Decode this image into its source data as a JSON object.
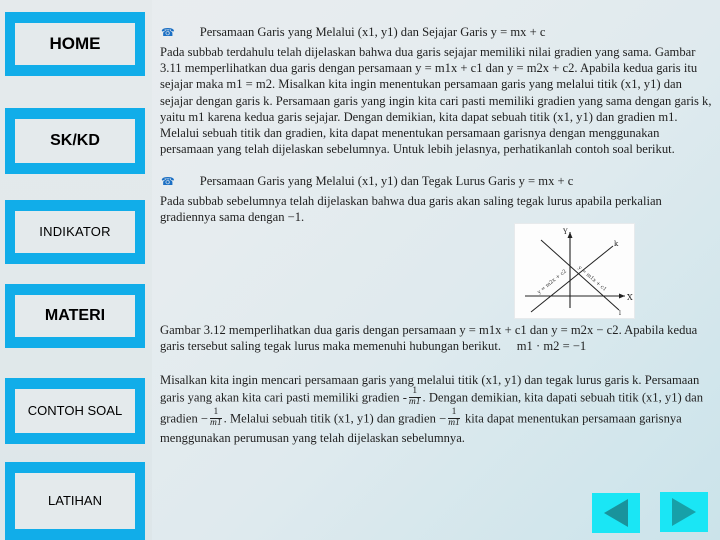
{
  "sidebar": {
    "items": [
      {
        "id": "home",
        "label": "HOME"
      },
      {
        "id": "skkd",
        "label": "SK/KD"
      },
      {
        "id": "indikator",
        "label": "INDIKATOR"
      },
      {
        "id": "materi",
        "label": "MATERI"
      },
      {
        "id": "contoh",
        "label": "CONTOH SOAL"
      },
      {
        "id": "latihan",
        "label": "LATIHAN"
      }
    ],
    "accent_color": "#11ade9",
    "button_face_color": "#e4eaec"
  },
  "content": {
    "bullet_glyph": "ὠ0",
    "heading1": "Persamaan Garis yang Melalui (x1, y1) dan Sejajar Garis y = mx + c",
    "paragraph1": "Pada subbab terdahulu telah dijelaskan bahwa dua garis sejajar memiliki nilai gradien yang sama. Gambar 3.11 memperlihatkan dua garis dengan persamaan y = m1x + c1 dan y = m2x + c2. Apabila kedua garis itu sejajar maka m1 = m2. Misalkan kita ingin menentukan persamaan garis yang melalui titik (x1, y1) dan sejajar dengan garis k. Persamaan garis yang ingin kita cari pasti memiliki gradien yang sama dengan garis k, yaitu m1 karena kedua garis sejajar. Dengan demikian, kita dapat sebuah titik (x1, y1) dan gradien m1. Melalui sebuah titik dan gradien, kita dapat menentukan persamaan garisnya dengan menggunakan persamaan yang telah dijelaskan sebelumnya. Untuk lebih jelasnya, perhatikanlah contoh soal berikut.",
    "heading2": "Persamaan Garis yang Melalui (x1, y1) dan Tegak Lurus Garis y = mx + c",
    "paragraph2": "Pada subbab sebelumnya telah dijelaskan bahwa dua garis akan saling tegak lurus apabila perkalian gradiennya sama dengan −1.",
    "paragraph3_a": "Gambar 3.12 memperlihatkan dua garis dengan persamaan y = m1x + c1 dan y = m2x − c2. Apabila kedua garis tersebut saling tegak lurus maka memenuhi hubungan berikut.",
    "paragraph3_b": "m1 · m2 = −1",
    "paragraph4_part1": "Misalkan kita ingin mencari persamaan garis yang melalui titik (x1, y1) dan tegak lurus garis k. Persamaan garis yang akan kita cari pasti memiliki gradien -",
    "paragraph4_part2": ". Dengan demikian, kita dapati sebuah titik (x1, y1) dan gradien −",
    "paragraph4_part3": ". Melalui sebuah titik (x1, y1) dan gradien −",
    "paragraph4_part4": " kita dapat menentukan persamaan garisnya menggunakan perumusan yang telah dijelaskan sebelumnya.",
    "fraction_numerator": "1",
    "fraction_denominator": "m1"
  },
  "figure": {
    "axis_x_label": "X",
    "axis_y_label": "Y",
    "line_k_label": "k",
    "line_l_label": "l",
    "line_k_equation": "y = m1x + c1",
    "line_l_equation": "y = m2x − c2"
  },
  "navigation": {
    "prev_label": "◀",
    "next_label": "▶",
    "button_color": "#1ae6f5",
    "prev_triangle_color": "#19939c",
    "next_triangle_color": "#17a0a8"
  }
}
